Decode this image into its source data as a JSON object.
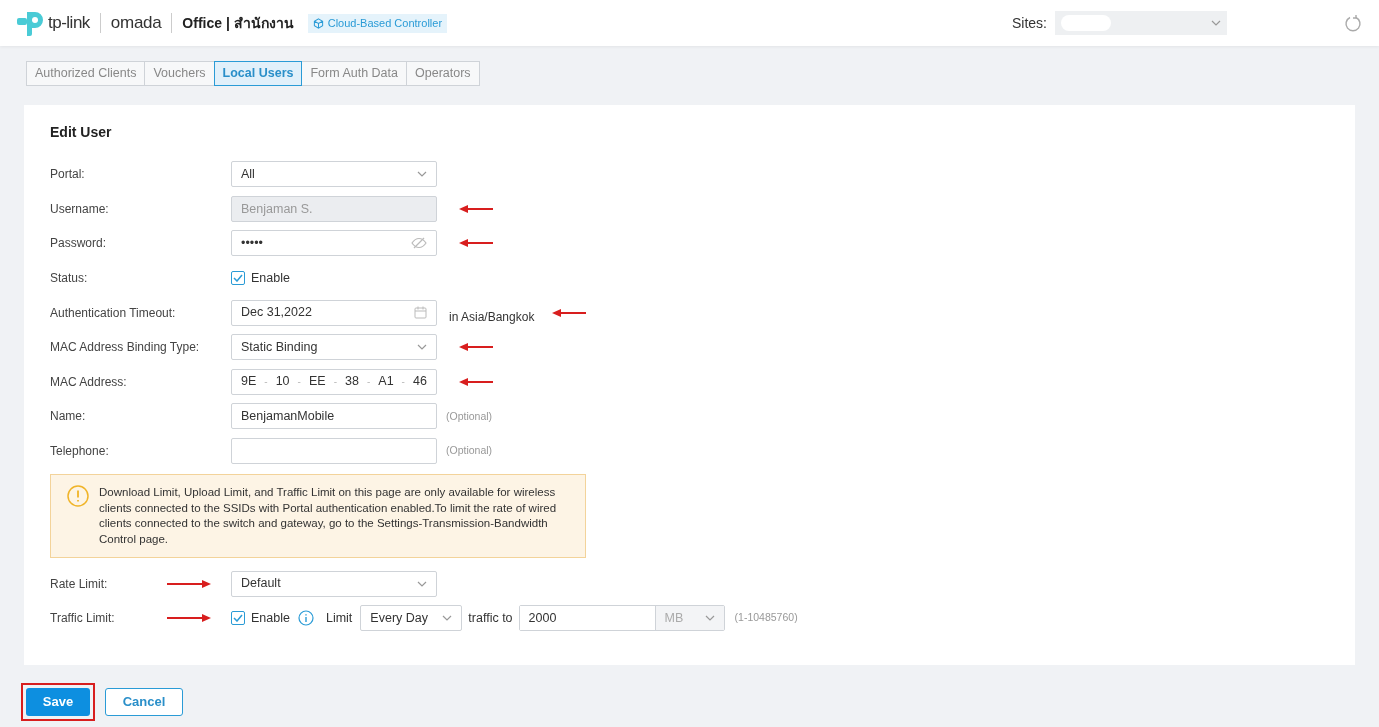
{
  "header": {
    "brand": "tp-link",
    "product": "omada",
    "site_title": "Office | สำนักงาน",
    "badge": "Cloud-Based Controller",
    "sites_label": "Sites:"
  },
  "tabs": [
    {
      "label": "Authorized Clients",
      "selected": false
    },
    {
      "label": "Vouchers",
      "selected": false
    },
    {
      "label": "Local Users",
      "selected": true
    },
    {
      "label": "Form Auth Data",
      "selected": false
    },
    {
      "label": "Operators",
      "selected": false
    }
  ],
  "form": {
    "title": "Edit User",
    "rows": [
      {
        "kind": "select",
        "label": "Portal:",
        "value": "All"
      },
      {
        "kind": "text",
        "label": "Username:",
        "value": "Benjaman S.",
        "disabled": true,
        "arrow_after": true
      },
      {
        "kind": "password",
        "label": "Password:",
        "value": "•••••",
        "arrow_after": true
      },
      {
        "kind": "checkbox",
        "label": "Status:",
        "text": "Enable",
        "checked": true
      },
      {
        "kind": "date",
        "label": "Authentication Timeout:",
        "value": "Dec 31,2022",
        "suffix": "in Asia/Bangkok",
        "arrow_after": true
      },
      {
        "kind": "select",
        "label": "MAC Address Binding Type:",
        "value": "Static Binding",
        "arrow_after": true
      },
      {
        "kind": "mac",
        "label": "MAC Address:",
        "parts": [
          "9E",
          "10",
          "EE",
          "38",
          "A1",
          "46"
        ],
        "separator": "-",
        "arrow_after": true
      },
      {
        "kind": "text",
        "label": "Name:",
        "value": "BenjamanMobile",
        "disabled": false,
        "note": "(Optional)"
      },
      {
        "kind": "text",
        "label": "Telephone:",
        "disabled": false,
        "note": "(Optional)"
      }
    ],
    "notice": "Download Limit, Upload Limit, and Traffic Limit on this page are only available for wireless clients connected to the SSIDs with Portal authentication enabled.To limit the rate of wired clients connected to the switch and gateway, go to the Settings-Transmission-Bandwidth Control page.",
    "limits": [
      {
        "kind": "select",
        "label": "Rate Limit:",
        "value": "Default",
        "arrow_before": true
      },
      {
        "kind": "traffic",
        "label": "Traffic Limit:",
        "arrow_before": true,
        "checked": true,
        "text": "Enable",
        "limit_label": "Limit",
        "period": "Every Day",
        "traffic_label": "traffic to",
        "value": "2000",
        "unit": "MB",
        "range": "(1-10485760)"
      }
    ]
  },
  "buttons": [
    {
      "label": "Save",
      "kind": "primary",
      "highlighted": true
    },
    {
      "label": "Cancel",
      "kind": "secondary",
      "highlighted": false
    }
  ]
}
